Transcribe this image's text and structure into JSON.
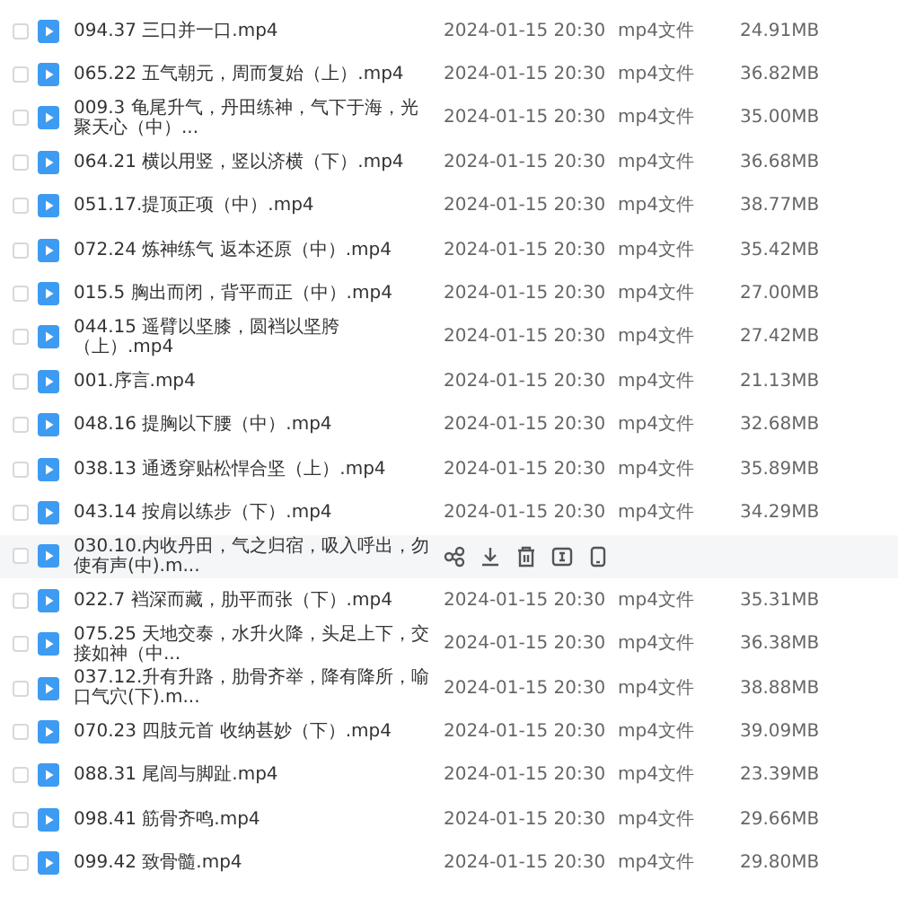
{
  "files": [
    {
      "name": "094.37 三口并一口.mp4",
      "checked": false,
      "hovered": false,
      "date": "2024-01-15 20:30",
      "type": "mp4文件",
      "size": "24.91MB"
    },
    {
      "name": "065.22 五气朝元，周而复始（上）.mp4",
      "checked": false,
      "hovered": false,
      "date": "2024-01-15 20:30",
      "type": "mp4文件",
      "size": "36.82MB"
    },
    {
      "name": "009.3 龟尾升气，丹田练神，气下于海，光聚天心（中）...",
      "checked": false,
      "hovered": false,
      "date": "2024-01-15 20:30",
      "type": "mp4文件",
      "size": "35.00MB"
    },
    {
      "name": "064.21 横以用竖，竖以济横（下）.mp4",
      "checked": false,
      "hovered": false,
      "date": "2024-01-15 20:30",
      "type": "mp4文件",
      "size": "36.68MB"
    },
    {
      "name": "051.17.提顶正项（中）.mp4",
      "checked": false,
      "hovered": false,
      "date": "2024-01-15 20:30",
      "type": "mp4文件",
      "size": "38.77MB"
    },
    {
      "name": "072.24 炼神练气 返本还原（中）.mp4",
      "checked": false,
      "hovered": false,
      "date": "2024-01-15 20:30",
      "type": "mp4文件",
      "size": "35.42MB"
    },
    {
      "name": "015.5 胸出而闭，背平而正（中）.mp4",
      "checked": false,
      "hovered": false,
      "date": "2024-01-15 20:30",
      "type": "mp4文件",
      "size": "27.00MB"
    },
    {
      "name": "044.15 遥臂以坚膝，圆裆以坚胯（上）.mp4",
      "checked": false,
      "hovered": false,
      "date": "2024-01-15 20:30",
      "type": "mp4文件",
      "size": "27.42MB"
    },
    {
      "name": "001.序言.mp4",
      "checked": false,
      "hovered": false,
      "date": "2024-01-15 20:30",
      "type": "mp4文件",
      "size": "21.13MB"
    },
    {
      "name": "048.16 提胸以下腰（中）.mp4",
      "checked": false,
      "hovered": false,
      "date": "2024-01-15 20:30",
      "type": "mp4文件",
      "size": "32.68MB"
    },
    {
      "name": "038.13 通透穿贴松悍合坚（上）.mp4",
      "checked": false,
      "hovered": false,
      "date": "2024-01-15 20:30",
      "type": "mp4文件",
      "size": "35.89MB"
    },
    {
      "name": "043.14 按肩以练步（下）.mp4",
      "checked": false,
      "hovered": false,
      "date": "2024-01-15 20:30",
      "type": "mp4文件",
      "size": "34.29MB"
    },
    {
      "name": "030.10.内收丹田，气之归宿，吸入呼出，勿使有声(中).m...",
      "checked": false,
      "hovered": true
    },
    {
      "name": "022.7 裆深而藏，肋平而张（下）.mp4",
      "checked": false,
      "hovered": false,
      "date": "2024-01-15 20:30",
      "type": "mp4文件",
      "size": "35.31MB"
    },
    {
      "name": "075.25 天地交泰，水升火降，头足上下，交接如神（中...",
      "checked": false,
      "hovered": false,
      "date": "2024-01-15 20:30",
      "type": "mp4文件",
      "size": "36.38MB"
    },
    {
      "name": "037.12.升有升路，肋骨齐举，降有降所，喻口气穴(下).m...",
      "checked": false,
      "hovered": false,
      "date": "2024-01-15 20:30",
      "type": "mp4文件",
      "size": "38.88MB"
    },
    {
      "name": "070.23 四肢元首 收纳甚妙（下）.mp4",
      "checked": false,
      "hovered": false,
      "date": "2024-01-15 20:30",
      "type": "mp4文件",
      "size": "39.09MB"
    },
    {
      "name": "088.31 尾闾与脚趾.mp4",
      "checked": false,
      "hovered": false,
      "date": "2024-01-15 20:30",
      "type": "mp4文件",
      "size": "23.39MB"
    },
    {
      "name": "098.41 筋骨齐鸣.mp4",
      "checked": false,
      "hovered": false,
      "date": "2024-01-15 20:30",
      "type": "mp4文件",
      "size": "29.66MB"
    },
    {
      "name": "099.42 致骨髓.mp4",
      "checked": false,
      "hovered": false,
      "date": "2024-01-15 20:30",
      "type": "mp4文件",
      "size": "29.80MB"
    }
  ]
}
